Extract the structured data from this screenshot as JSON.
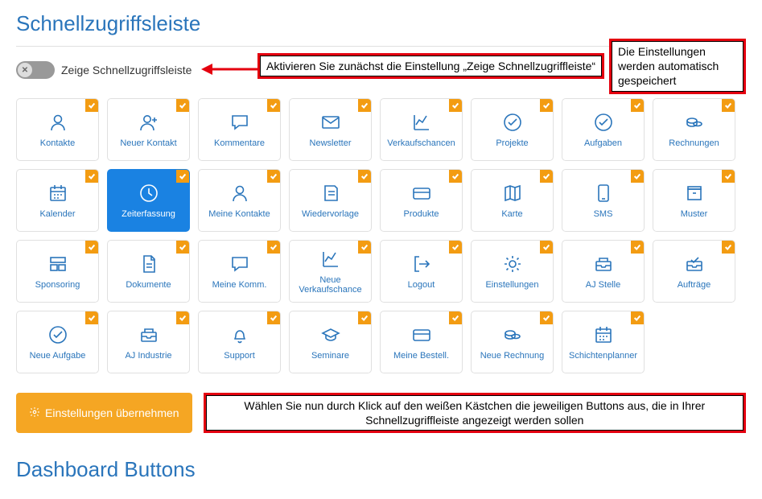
{
  "title": "Schnellzugriffsleiste",
  "toggle": {
    "label": "Zeige Schnellzugriffsleiste"
  },
  "annotations": {
    "activate": "Aktivieren Sie zunächst die Einstellung „Zeige Schnellzugriffleiste“",
    "autosave": "Die Einstellungen werden automatisch gespeichert",
    "select": "Wählen Sie nun durch Klick auf den weißen Kästchen die jeweiligen Buttons aus, die in Ihrer Schnellzugriffleiste angezeigt werden sollen"
  },
  "tiles": [
    {
      "label": "Kontakte",
      "icon": "person"
    },
    {
      "label": "Neuer Kontakt",
      "icon": "person-plus"
    },
    {
      "label": "Kommentare",
      "icon": "comment"
    },
    {
      "label": "Newsletter",
      "icon": "envelope"
    },
    {
      "label": "Verkaufschancen",
      "icon": "chart"
    },
    {
      "label": "Projekte",
      "icon": "check-circle"
    },
    {
      "label": "Aufgaben",
      "icon": "check-circle"
    },
    {
      "label": "Rechnungen",
      "icon": "coins"
    },
    {
      "label": "Kalender",
      "icon": "calendar"
    },
    {
      "label": "Zeiterfassung",
      "icon": "clock",
      "active": true
    },
    {
      "label": "Meine Kontakte",
      "icon": "person"
    },
    {
      "label": "Wiedervorlage",
      "icon": "note"
    },
    {
      "label": "Produkte",
      "icon": "card"
    },
    {
      "label": "Karte",
      "icon": "map"
    },
    {
      "label": "SMS",
      "icon": "phone"
    },
    {
      "label": "Muster",
      "icon": "box"
    },
    {
      "label": "Sponsoring",
      "icon": "layout"
    },
    {
      "label": "Dokumente",
      "icon": "document"
    },
    {
      "label": "Meine Komm.",
      "icon": "comment"
    },
    {
      "label": "Neue Verkaufschance",
      "icon": "chart"
    },
    {
      "label": "Logout",
      "icon": "logout"
    },
    {
      "label": "Einstellungen",
      "icon": "gear"
    },
    {
      "label": "AJ Stelle",
      "icon": "tray"
    },
    {
      "label": "Aufträge",
      "icon": "tray-check"
    },
    {
      "label": "Neue Aufgabe",
      "icon": "check-circle"
    },
    {
      "label": "AJ Industrie",
      "icon": "tray"
    },
    {
      "label": "Support",
      "icon": "bell"
    },
    {
      "label": "Seminare",
      "icon": "hat"
    },
    {
      "label": "Meine Bestell.",
      "icon": "card"
    },
    {
      "label": "Neue Rechnung",
      "icon": "coins"
    },
    {
      "label": "Schichtenplanner",
      "icon": "calendar"
    }
  ],
  "apply_button": "Einstellungen übernehmen",
  "subtitle": "Dashboard Buttons"
}
